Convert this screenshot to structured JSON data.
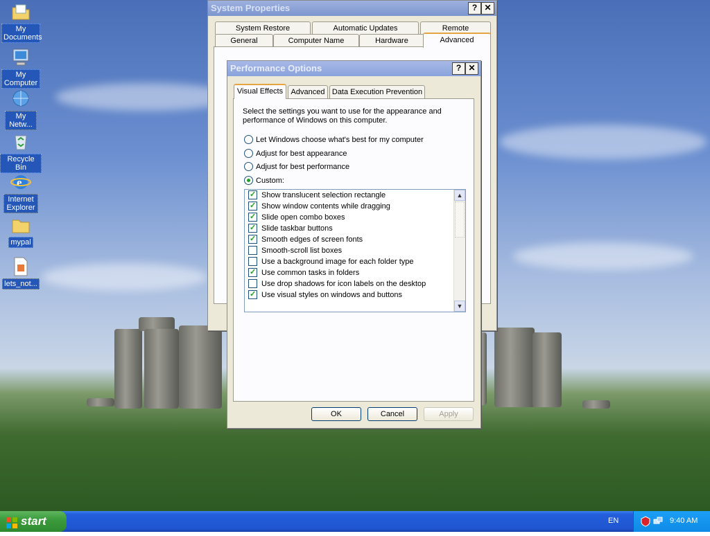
{
  "desktop_icons": [
    {
      "name": "my-documents",
      "label": "My Documents",
      "icon": "folder-documents-icon"
    },
    {
      "name": "my-computer",
      "label": "My Computer",
      "icon": "computer-icon"
    },
    {
      "name": "my-network",
      "label": "My Netw...",
      "icon": "network-icon"
    },
    {
      "name": "recycle-bin",
      "label": "Recycle Bin",
      "icon": "recycle-bin-icon"
    },
    {
      "name": "internet-explorer",
      "label": "Internet Explorer",
      "icon": "internet-explorer-icon"
    },
    {
      "name": "mypal",
      "label": "mypal",
      "icon": "folder-icon"
    },
    {
      "name": "lets-not",
      "label": "lets_not...",
      "icon": "file-icon"
    }
  ],
  "system_properties": {
    "title": "System Properties",
    "tabs_row1": [
      "System Restore",
      "Automatic Updates",
      "Remote"
    ],
    "tabs_row2": [
      "General",
      "Computer Name",
      "Hardware",
      "Advanced"
    ]
  },
  "performance_options": {
    "title": "Performance Options",
    "tabs": [
      "Visual Effects",
      "Advanced",
      "Data Execution Prevention"
    ],
    "description": "Select the settings you want to use for the appearance and performance of Windows on this computer.",
    "radios": [
      {
        "label": "Let Windows choose what's best for my computer",
        "checked": false
      },
      {
        "label": "Adjust for best appearance",
        "checked": false
      },
      {
        "label": "Adjust for best performance",
        "checked": false
      },
      {
        "label": "Custom:",
        "checked": true
      }
    ],
    "effects": [
      {
        "label": "Show translucent selection rectangle",
        "checked": true
      },
      {
        "label": "Show window contents while dragging",
        "checked": true
      },
      {
        "label": "Slide open combo boxes",
        "checked": true
      },
      {
        "label": "Slide taskbar buttons",
        "checked": true
      },
      {
        "label": "Smooth edges of screen fonts",
        "checked": true
      },
      {
        "label": "Smooth-scroll list boxes",
        "checked": false
      },
      {
        "label": "Use a background image for each folder type",
        "checked": false
      },
      {
        "label": "Use common tasks in folders",
        "checked": true
      },
      {
        "label": "Use drop shadows for icon labels on the desktop",
        "checked": false
      },
      {
        "label": "Use visual styles on windows and buttons",
        "checked": true
      }
    ],
    "buttons": {
      "ok": "OK",
      "cancel": "Cancel",
      "apply": "Apply"
    }
  },
  "taskbar": {
    "start_label": "start",
    "language": "EN",
    "clock": "9:40 AM"
  }
}
